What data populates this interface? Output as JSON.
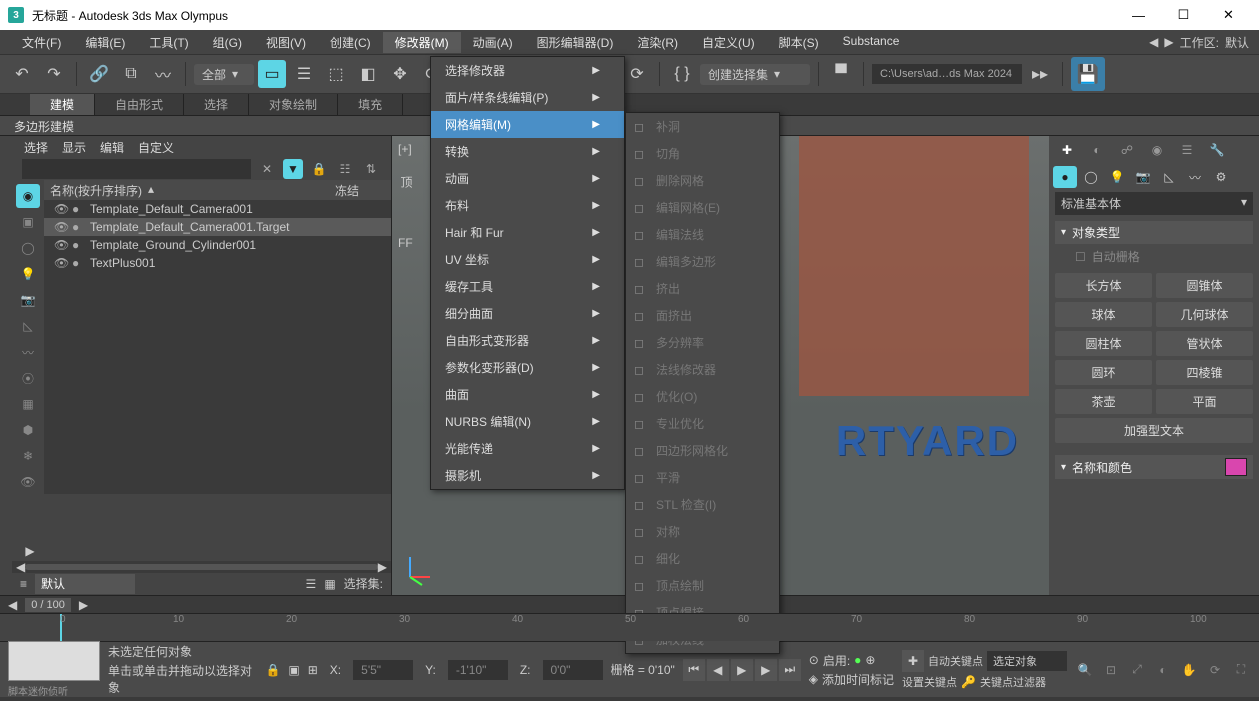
{
  "title": "无标题 - Autodesk 3ds Max Olympus",
  "menus": [
    "文件(F)",
    "编辑(E)",
    "工具(T)",
    "组(G)",
    "视图(V)",
    "创建(C)",
    "修改器(M)",
    "动画(A)",
    "图形编辑器(D)",
    "渲染(R)",
    "自定义(U)",
    "脚本(S)",
    "Substance"
  ],
  "active_menu": 6,
  "workspace_label": "工作区:",
  "workspace": "默认",
  "toolbar": {
    "scope": "全部",
    "create_select_set": "创建选择集",
    "path": "C:\\Users\\ad…ds Max 2024"
  },
  "ribbon": {
    "tabs": [
      "建模",
      "自由形式",
      "选择",
      "对象绘制",
      "填充"
    ],
    "active": 0,
    "sublabel": "多边形建模"
  },
  "scene": {
    "head": [
      "选择",
      "显示",
      "编辑",
      "自定义"
    ],
    "name_col": "名称(按升序排序)",
    "freeze_col": "冻结",
    "items": [
      {
        "label": "Template_Default_Camera001",
        "sel": false
      },
      {
        "label": "Template_Default_Camera001.Target",
        "sel": true
      },
      {
        "label": "Template_Ground_Cylinder001",
        "sel": false
      },
      {
        "label": "TextPlus001",
        "sel": false
      }
    ],
    "layer": "默认",
    "selset_label": "选择集:"
  },
  "viewport": {
    "corner": "[+]",
    "topview": "顶",
    "fp": "FF",
    "text3d": "RTYARD"
  },
  "dropdown1": [
    {
      "label": "选择修改器",
      "arrow": true
    },
    {
      "label": "面片/样条线编辑(P)",
      "arrow": true
    },
    {
      "label": "网格编辑(M)",
      "arrow": true,
      "hl": true
    },
    {
      "label": "转换",
      "arrow": true
    },
    {
      "label": "动画",
      "arrow": true
    },
    {
      "label": "布料",
      "arrow": true
    },
    {
      "label": "Hair 和 Fur",
      "arrow": true
    },
    {
      "label": "UV 坐标",
      "arrow": true
    },
    {
      "label": "缓存工具",
      "arrow": true
    },
    {
      "label": "细分曲面",
      "arrow": true
    },
    {
      "label": "自由形式变形器",
      "arrow": true
    },
    {
      "label": "参数化变形器(D)",
      "arrow": true
    },
    {
      "label": "曲面",
      "arrow": true
    },
    {
      "label": "NURBS 编辑(N)",
      "arrow": true
    },
    {
      "label": "光能传递",
      "arrow": true
    },
    {
      "label": "摄影机",
      "arrow": true
    }
  ],
  "dropdown2": [
    {
      "label": "补洞",
      "d": true
    },
    {
      "label": "切角",
      "d": true
    },
    {
      "label": "删除网格",
      "d": true
    },
    {
      "label": "编辑网格(E)",
      "d": true
    },
    {
      "label": "编辑法线",
      "d": true
    },
    {
      "label": "编辑多边形",
      "d": true
    },
    {
      "label": "挤出",
      "d": true
    },
    {
      "label": "面挤出",
      "d": true
    },
    {
      "label": "多分辨率",
      "d": true
    },
    {
      "label": "法线修改器",
      "d": true
    },
    {
      "label": "优化(O)",
      "d": true
    },
    {
      "label": "专业优化",
      "d": true
    },
    {
      "label": "四边形网格化",
      "d": true
    },
    {
      "label": "平滑",
      "d": true
    },
    {
      "label": "STL 检查(I)",
      "d": true
    },
    {
      "label": "对称",
      "d": true
    },
    {
      "label": "细化",
      "d": true
    },
    {
      "label": "顶点绘制",
      "d": true
    },
    {
      "label": "顶点焊接",
      "d": true
    },
    {
      "label": "加权法线",
      "d": true
    }
  ],
  "cmd": {
    "primitive": "标准基本体",
    "obj_type": "对象类型",
    "autogrid": "自动栅格",
    "btns": [
      "长方体",
      "圆锥体",
      "球体",
      "几何球体",
      "圆柱体",
      "管状体",
      "圆环",
      "四棱锥",
      "茶壶",
      "平面",
      "加强型文本"
    ],
    "name_color": "名称和颜色"
  },
  "timeline": {
    "frame": "0 / 100",
    "ticks": [
      0,
      10,
      20,
      30,
      40,
      50,
      60,
      70,
      80,
      90,
      100
    ]
  },
  "status": {
    "mini": "脚本迷你侦听",
    "line1": "未选定任何对象",
    "line2": "单击或单击并拖动以选择对象",
    "x": "X:",
    "xv": "5'5\"",
    "y": "Y:",
    "yv": "-1'10\"",
    "z": "Z:",
    "zv": "0'0\"",
    "grid": "栅格 = 0'10\"",
    "enable": "启用:",
    "add_time": "添加时间标记",
    "autokey": "自动关键点",
    "setkey": "设置关键点",
    "selobj": "选定对象",
    "keyfilter": "关键点过滤器"
  }
}
